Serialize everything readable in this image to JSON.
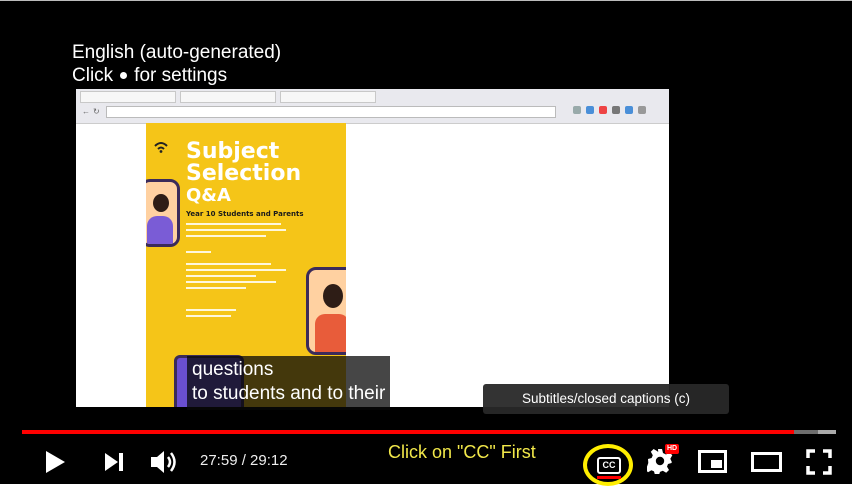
{
  "caption_settings_hint": {
    "line1": "English (auto-generated)",
    "line2_prefix": "Click",
    "line2_suffix": "for settings"
  },
  "video_frame": {
    "browser_tabs": [
      "",
      "",
      ""
    ],
    "url": "",
    "poster": {
      "title_lines": [
        "Subject",
        "Selection",
        "Q&A"
      ],
      "subtitle": "Year 10 Students and Parents",
      "side_note": ""
    }
  },
  "captions": {
    "line1": "questions",
    "line2": "to students and to their"
  },
  "tooltip": {
    "text": "Subtitles/closed captions (c)"
  },
  "progress": {
    "played_fraction": 0.948,
    "buffered_fraction": 0.97
  },
  "controls": {
    "time": "27:59 / 29:12",
    "annotation": "Click on \"CC\" First",
    "cc_label": "CC",
    "hd_badge": "HD",
    "icons": [
      "play-icon",
      "next-icon",
      "volume-icon",
      "cc-icon",
      "settings-icon",
      "miniplayer-icon",
      "theater-icon",
      "fullscreen-icon"
    ]
  },
  "colors": {
    "progress_red": "#ff0000",
    "annotation_yellow": "#f2e84a",
    "highlight_circle": "#ffee00",
    "poster_yellow": "#f5c518"
  }
}
